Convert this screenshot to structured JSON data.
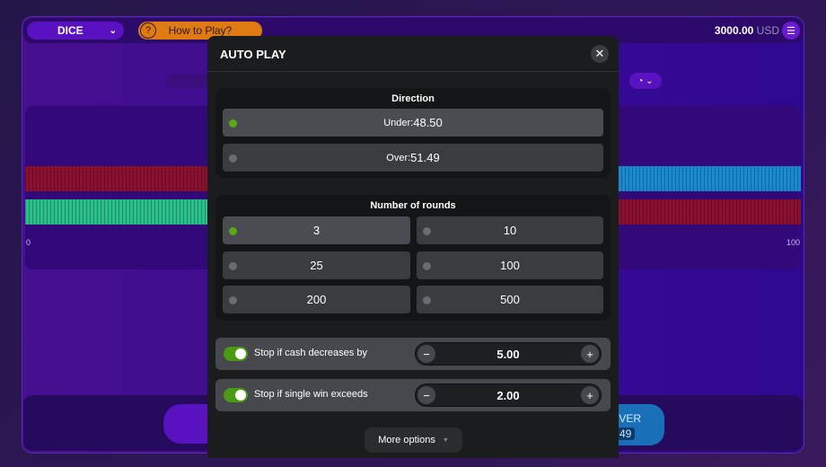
{
  "header": {
    "game": "DICE",
    "how_to_play": "How to Play?",
    "balance": "3000.00",
    "currency": "USD"
  },
  "graph": {
    "min_label": "0",
    "max_label": "100"
  },
  "bottom": {
    "over_label": "OVER",
    "over_value": "49"
  },
  "colors": {
    "accent": "#5ca818",
    "red": "#8a1030",
    "green": "#2ac08a",
    "blue": "#1a8ad0"
  },
  "modal": {
    "title": "AUTO PLAY",
    "direction": {
      "title": "Direction",
      "options": [
        {
          "label": "Under:",
          "value": "48.50",
          "selected": true
        },
        {
          "label": "Over:",
          "value": "51.49",
          "selected": false
        }
      ]
    },
    "rounds": {
      "title": "Number of rounds",
      "options": [
        "3",
        "10",
        "25",
        "100",
        "200",
        "500"
      ],
      "selected": "3"
    },
    "stops": [
      {
        "label": "Stop if cash decreases by",
        "value": "5.00",
        "enabled": true
      },
      {
        "label": "Stop if single win exceeds",
        "value": "2.00",
        "enabled": true
      }
    ],
    "more_options": "More options"
  }
}
